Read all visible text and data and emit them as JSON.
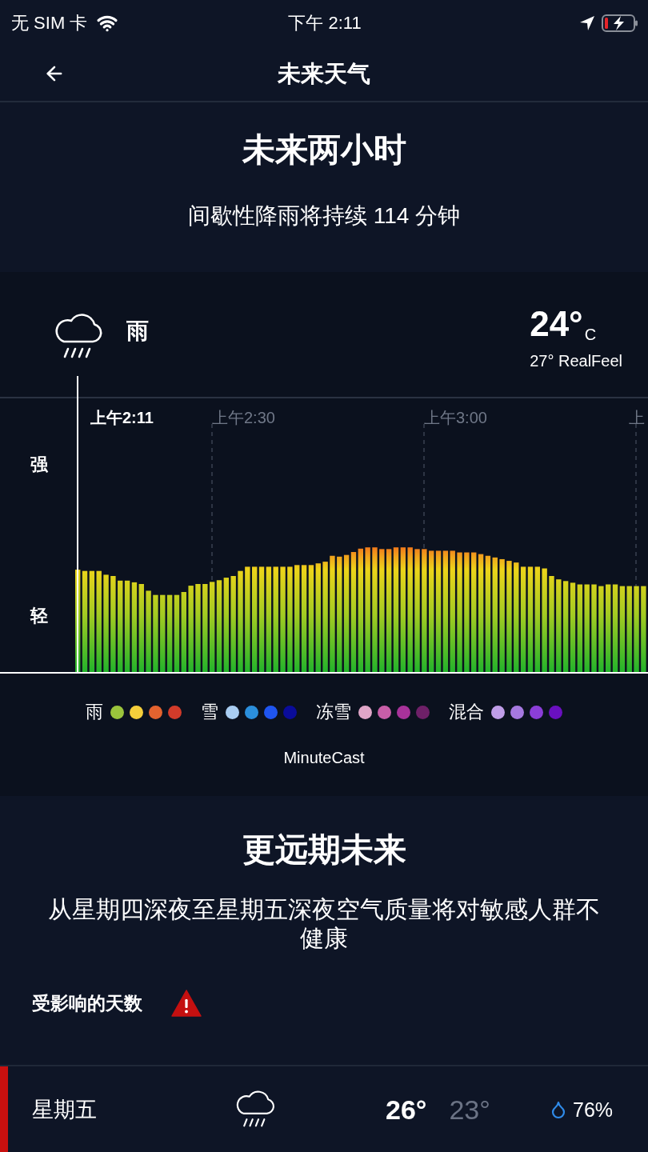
{
  "status_bar": {
    "carrier": "无 SIM 卡",
    "time": "下午 2:11"
  },
  "nav": {
    "title": "未来天气"
  },
  "next_two_hours": {
    "title": "未来两小时",
    "summary": "间歇性降雨将持续 114 分钟"
  },
  "current": {
    "condition": "雨",
    "temperature": "24°",
    "unit": "C",
    "realfeel": "27° RealFeel"
  },
  "minutecast": {
    "time_labels": [
      {
        "label": "上午2:11",
        "current": true
      },
      {
        "label": "上午2:30",
        "current": false
      },
      {
        "label": "上午3:00",
        "current": false
      },
      {
        "label": "上",
        "current": false
      }
    ],
    "intensity_labels": [
      "强",
      "轻"
    ],
    "legend": [
      {
        "label": "雨",
        "swatches": [
          {
            "color": "#9bc43c"
          },
          {
            "color": "#f5cf3b"
          },
          {
            "color": "#e4632f"
          },
          {
            "color": "#d23b2a"
          }
        ]
      },
      {
        "label": "雪",
        "swatches": [
          {
            "color": "#a9cdf2"
          },
          {
            "color": "#2b8fdc"
          },
          {
            "color": "#1f55f0"
          },
          {
            "color": "#0a0c9a"
          }
        ]
      },
      {
        "label": "冻雪",
        "swatches": [
          {
            "color": "#e0a6c8"
          },
          {
            "color": "#c85ea8"
          },
          {
            "color": "#a8329a"
          },
          {
            "color": "#6e2068"
          }
        ]
      },
      {
        "label": "混合",
        "swatches": [
          {
            "color": "#c09ee8"
          },
          {
            "color": "#a679e0"
          },
          {
            "color": "#8b3ed8"
          },
          {
            "color": "#6a10c0"
          }
        ]
      }
    ],
    "caption": "MinuteCast"
  },
  "further_future": {
    "title": "更远期未来",
    "summary": "从星期四深夜至星期五深夜空气质量将对敏感人群不健康",
    "affected_days_label": "受影响的天数",
    "alert": true
  },
  "days": [
    {
      "day": "星期五",
      "high": "26°",
      "low": "23°",
      "precipitation": "76%",
      "affected": true
    }
  ]
}
